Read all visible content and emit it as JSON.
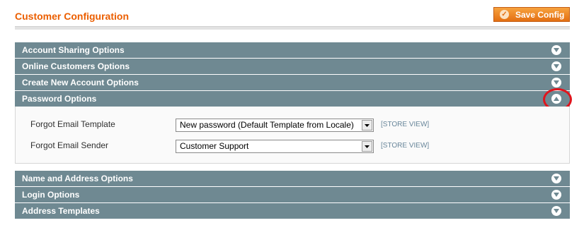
{
  "header": {
    "title": "Customer Configuration",
    "save_label": "Save Config",
    "save_icon": "check-icon"
  },
  "sections_top": [
    {
      "label": "Account Sharing Options",
      "state": "collapsed"
    },
    {
      "label": "Online Customers Options",
      "state": "collapsed"
    },
    {
      "label": "Create New Account Options",
      "state": "collapsed"
    },
    {
      "label": "Password Options",
      "state": "expanded"
    }
  ],
  "password_options": {
    "fields": [
      {
        "label": "Forgot Email Template",
        "value": "New password (Default Template from Locale)",
        "scope": "[STORE VIEW]"
      },
      {
        "label": "Forgot Email Sender",
        "value": "Customer Support",
        "scope": "[STORE VIEW]"
      }
    ]
  },
  "sections_bottom": [
    {
      "label": "Name and Address Options",
      "state": "collapsed"
    },
    {
      "label": "Login Options",
      "state": "collapsed"
    },
    {
      "label": "Address Templates",
      "state": "collapsed"
    }
  ],
  "colors": {
    "accent": "#eb5e00",
    "section_bar": "#6f8992",
    "highlight": "#e0141c"
  }
}
